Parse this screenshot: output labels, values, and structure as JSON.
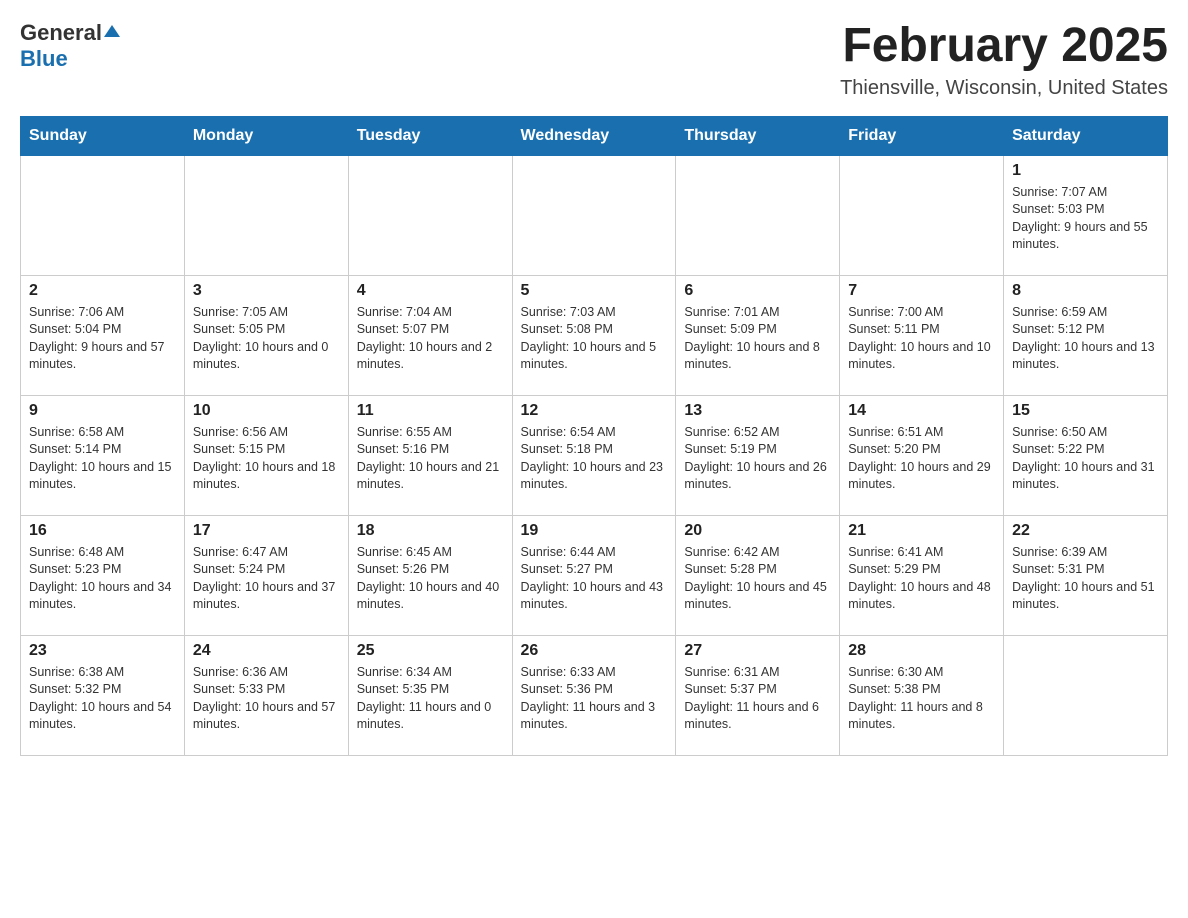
{
  "logo": {
    "general": "General",
    "blue": "Blue"
  },
  "header": {
    "title": "February 2025",
    "subtitle": "Thiensville, Wisconsin, United States"
  },
  "weekdays": [
    "Sunday",
    "Monday",
    "Tuesday",
    "Wednesday",
    "Thursday",
    "Friday",
    "Saturday"
  ],
  "weeks": [
    [
      {
        "day": "",
        "info": ""
      },
      {
        "day": "",
        "info": ""
      },
      {
        "day": "",
        "info": ""
      },
      {
        "day": "",
        "info": ""
      },
      {
        "day": "",
        "info": ""
      },
      {
        "day": "",
        "info": ""
      },
      {
        "day": "1",
        "info": "Sunrise: 7:07 AM\nSunset: 5:03 PM\nDaylight: 9 hours and 55 minutes."
      }
    ],
    [
      {
        "day": "2",
        "info": "Sunrise: 7:06 AM\nSunset: 5:04 PM\nDaylight: 9 hours and 57 minutes."
      },
      {
        "day": "3",
        "info": "Sunrise: 7:05 AM\nSunset: 5:05 PM\nDaylight: 10 hours and 0 minutes."
      },
      {
        "day": "4",
        "info": "Sunrise: 7:04 AM\nSunset: 5:07 PM\nDaylight: 10 hours and 2 minutes."
      },
      {
        "day": "5",
        "info": "Sunrise: 7:03 AM\nSunset: 5:08 PM\nDaylight: 10 hours and 5 minutes."
      },
      {
        "day": "6",
        "info": "Sunrise: 7:01 AM\nSunset: 5:09 PM\nDaylight: 10 hours and 8 minutes."
      },
      {
        "day": "7",
        "info": "Sunrise: 7:00 AM\nSunset: 5:11 PM\nDaylight: 10 hours and 10 minutes."
      },
      {
        "day": "8",
        "info": "Sunrise: 6:59 AM\nSunset: 5:12 PM\nDaylight: 10 hours and 13 minutes."
      }
    ],
    [
      {
        "day": "9",
        "info": "Sunrise: 6:58 AM\nSunset: 5:14 PM\nDaylight: 10 hours and 15 minutes."
      },
      {
        "day": "10",
        "info": "Sunrise: 6:56 AM\nSunset: 5:15 PM\nDaylight: 10 hours and 18 minutes."
      },
      {
        "day": "11",
        "info": "Sunrise: 6:55 AM\nSunset: 5:16 PM\nDaylight: 10 hours and 21 minutes."
      },
      {
        "day": "12",
        "info": "Sunrise: 6:54 AM\nSunset: 5:18 PM\nDaylight: 10 hours and 23 minutes."
      },
      {
        "day": "13",
        "info": "Sunrise: 6:52 AM\nSunset: 5:19 PM\nDaylight: 10 hours and 26 minutes."
      },
      {
        "day": "14",
        "info": "Sunrise: 6:51 AM\nSunset: 5:20 PM\nDaylight: 10 hours and 29 minutes."
      },
      {
        "day": "15",
        "info": "Sunrise: 6:50 AM\nSunset: 5:22 PM\nDaylight: 10 hours and 31 minutes."
      }
    ],
    [
      {
        "day": "16",
        "info": "Sunrise: 6:48 AM\nSunset: 5:23 PM\nDaylight: 10 hours and 34 minutes."
      },
      {
        "day": "17",
        "info": "Sunrise: 6:47 AM\nSunset: 5:24 PM\nDaylight: 10 hours and 37 minutes."
      },
      {
        "day": "18",
        "info": "Sunrise: 6:45 AM\nSunset: 5:26 PM\nDaylight: 10 hours and 40 minutes."
      },
      {
        "day": "19",
        "info": "Sunrise: 6:44 AM\nSunset: 5:27 PM\nDaylight: 10 hours and 43 minutes."
      },
      {
        "day": "20",
        "info": "Sunrise: 6:42 AM\nSunset: 5:28 PM\nDaylight: 10 hours and 45 minutes."
      },
      {
        "day": "21",
        "info": "Sunrise: 6:41 AM\nSunset: 5:29 PM\nDaylight: 10 hours and 48 minutes."
      },
      {
        "day": "22",
        "info": "Sunrise: 6:39 AM\nSunset: 5:31 PM\nDaylight: 10 hours and 51 minutes."
      }
    ],
    [
      {
        "day": "23",
        "info": "Sunrise: 6:38 AM\nSunset: 5:32 PM\nDaylight: 10 hours and 54 minutes."
      },
      {
        "day": "24",
        "info": "Sunrise: 6:36 AM\nSunset: 5:33 PM\nDaylight: 10 hours and 57 minutes."
      },
      {
        "day": "25",
        "info": "Sunrise: 6:34 AM\nSunset: 5:35 PM\nDaylight: 11 hours and 0 minutes."
      },
      {
        "day": "26",
        "info": "Sunrise: 6:33 AM\nSunset: 5:36 PM\nDaylight: 11 hours and 3 minutes."
      },
      {
        "day": "27",
        "info": "Sunrise: 6:31 AM\nSunset: 5:37 PM\nDaylight: 11 hours and 6 minutes."
      },
      {
        "day": "28",
        "info": "Sunrise: 6:30 AM\nSunset: 5:38 PM\nDaylight: 11 hours and 8 minutes."
      },
      {
        "day": "",
        "info": ""
      }
    ]
  ]
}
